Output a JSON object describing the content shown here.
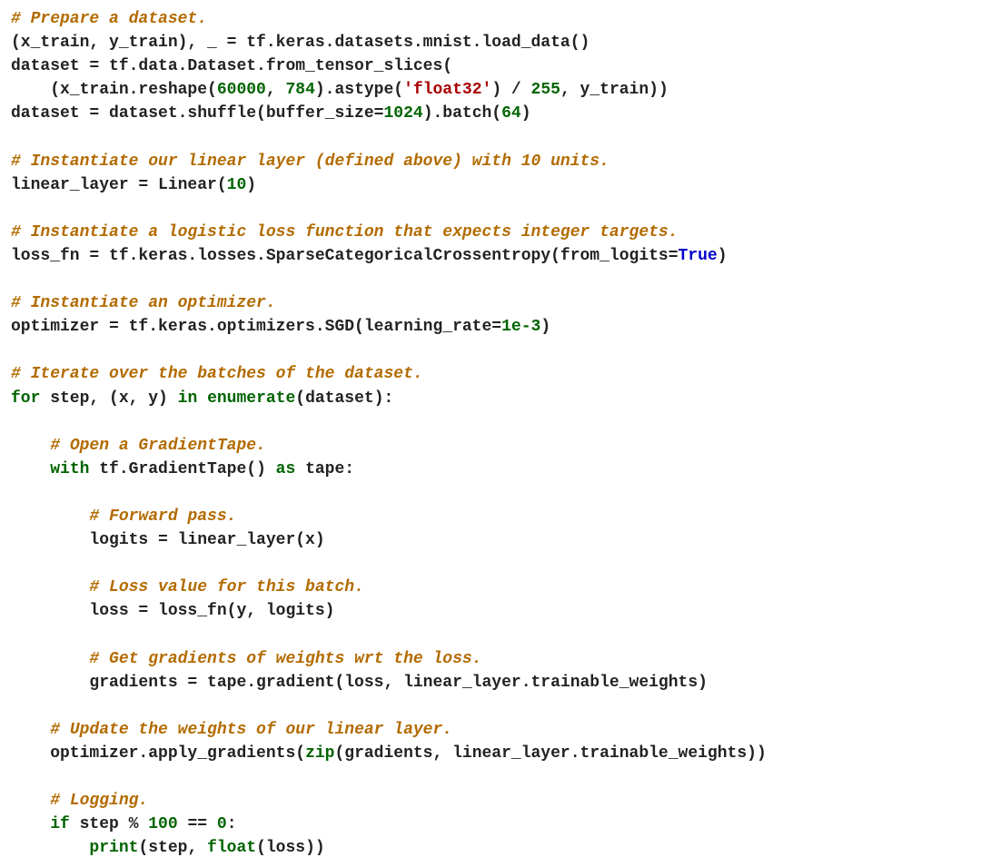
{
  "code_lines": [
    [
      {
        "cls": "c",
        "t": "# Prepare a dataset."
      }
    ],
    [
      {
        "t": "(x_train, y_train), _ = tf.keras.datasets.mnist.load_data()"
      }
    ],
    [
      {
        "t": "dataset = tf.data.Dataset.from_tensor_slices("
      }
    ],
    [
      {
        "t": "    (x_train.reshape("
      },
      {
        "cls": "num",
        "t": "60000"
      },
      {
        "t": ", "
      },
      {
        "cls": "num",
        "t": "784"
      },
      {
        "t": ").astype("
      },
      {
        "cls": "s",
        "t": "'float32'"
      },
      {
        "t": ") / "
      },
      {
        "cls": "num",
        "t": "255"
      },
      {
        "t": ", y_train))"
      }
    ],
    [
      {
        "t": "dataset = dataset.shuffle(buffer_size="
      },
      {
        "cls": "num",
        "t": "1024"
      },
      {
        "t": ").batch("
      },
      {
        "cls": "num",
        "t": "64"
      },
      {
        "t": ")"
      }
    ],
    [
      {
        "t": ""
      }
    ],
    [
      {
        "cls": "c",
        "t": "# Instantiate our linear layer (defined above) with 10 units."
      }
    ],
    [
      {
        "t": "linear_layer = Linear("
      },
      {
        "cls": "num",
        "t": "10"
      },
      {
        "t": ")"
      }
    ],
    [
      {
        "t": ""
      }
    ],
    [
      {
        "cls": "c",
        "t": "# Instantiate a logistic loss function that expects integer targets."
      }
    ],
    [
      {
        "t": "loss_fn = tf.keras.losses.SparseCategoricalCrossentropy(from_logits="
      },
      {
        "cls": "nc",
        "t": "True"
      },
      {
        "t": ")"
      }
    ],
    [
      {
        "t": ""
      }
    ],
    [
      {
        "cls": "c",
        "t": "# Instantiate an optimizer."
      }
    ],
    [
      {
        "t": "optimizer = tf.keras.optimizers.SGD(learning_rate="
      },
      {
        "cls": "num",
        "t": "1e-3"
      },
      {
        "t": ")"
      }
    ],
    [
      {
        "t": ""
      }
    ],
    [
      {
        "cls": "c",
        "t": "# Iterate over the batches of the dataset."
      }
    ],
    [
      {
        "cls": "k",
        "t": "for"
      },
      {
        "t": " step, (x, y) "
      },
      {
        "cls": "k",
        "t": "in"
      },
      {
        "t": " "
      },
      {
        "cls": "bi",
        "t": "enumerate"
      },
      {
        "t": "(dataset):"
      }
    ],
    [
      {
        "t": ""
      }
    ],
    [
      {
        "t": "    "
      },
      {
        "cls": "c",
        "t": "# Open a GradientTape."
      }
    ],
    [
      {
        "t": "    "
      },
      {
        "cls": "k",
        "t": "with"
      },
      {
        "t": " tf.GradientTape() "
      },
      {
        "cls": "k",
        "t": "as"
      },
      {
        "t": " tape:"
      }
    ],
    [
      {
        "t": ""
      }
    ],
    [
      {
        "t": "        "
      },
      {
        "cls": "c",
        "t": "# Forward pass."
      }
    ],
    [
      {
        "t": "        logits = linear_layer(x)"
      }
    ],
    [
      {
        "t": ""
      }
    ],
    [
      {
        "t": "        "
      },
      {
        "cls": "c",
        "t": "# Loss value for this batch."
      }
    ],
    [
      {
        "t": "        loss = loss_fn(y, logits)"
      }
    ],
    [
      {
        "t": ""
      }
    ],
    [
      {
        "t": "        "
      },
      {
        "cls": "c",
        "t": "# Get gradients of weights wrt the loss."
      }
    ],
    [
      {
        "t": "        gradients = tape.gradient(loss, linear_layer.trainable_weights)"
      }
    ],
    [
      {
        "t": ""
      }
    ],
    [
      {
        "t": "    "
      },
      {
        "cls": "c",
        "t": "# Update the weights of our linear layer."
      }
    ],
    [
      {
        "t": "    optimizer.apply_gradients("
      },
      {
        "cls": "bi",
        "t": "zip"
      },
      {
        "t": "(gradients, linear_layer.trainable_weights))"
      }
    ],
    [
      {
        "t": ""
      }
    ],
    [
      {
        "t": "    "
      },
      {
        "cls": "c",
        "t": "# Logging."
      }
    ],
    [
      {
        "t": "    "
      },
      {
        "cls": "k",
        "t": "if"
      },
      {
        "t": " step % "
      },
      {
        "cls": "num",
        "t": "100"
      },
      {
        "t": " == "
      },
      {
        "cls": "num",
        "t": "0"
      },
      {
        "t": ":"
      }
    ],
    [
      {
        "t": "        "
      },
      {
        "cls": "bi",
        "t": "print"
      },
      {
        "t": "(step, "
      },
      {
        "cls": "bi",
        "t": "float"
      },
      {
        "t": "(loss))"
      }
    ]
  ]
}
